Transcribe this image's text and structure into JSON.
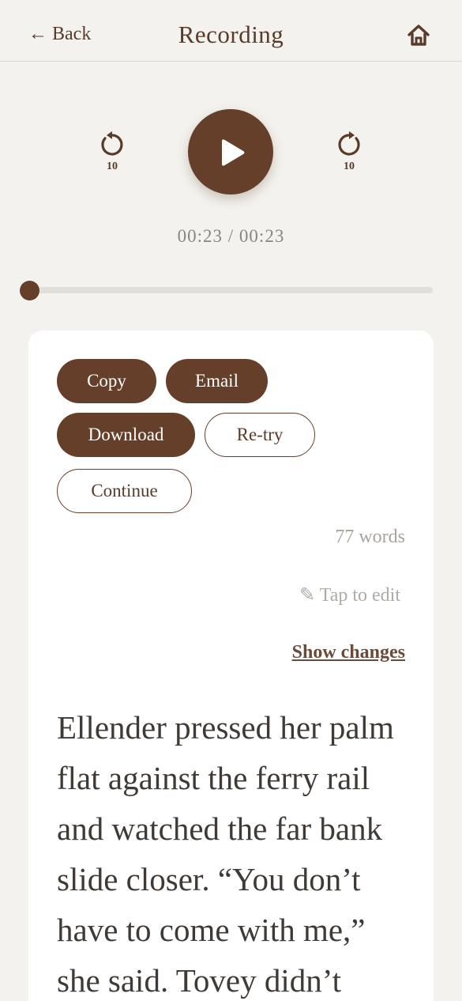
{
  "header": {
    "back_label": "← Back",
    "title": "Recording",
    "home_icon": "home-icon"
  },
  "player": {
    "rewind_label": "10",
    "forward_label": "10",
    "time": "00:23 / 00:23",
    "progress": 0
  },
  "actions": {
    "copy": "Copy",
    "email": "Email",
    "download": "Download",
    "retry": "Re-try",
    "continue": "Continue"
  },
  "transcript": {
    "word_count": "77 words",
    "tap_to_edit": "✎ Tap to edit",
    "show_changes": "Show changes",
    "text": "Ellender pressed her palm flat against the ferry rail and watched the far bank slide closer. “You don’t have to come with me,” she said. Tovey didn’t"
  },
  "colors": {
    "accent": "#663f2b",
    "background": "#f4f2ee",
    "card": "#ffffff"
  }
}
